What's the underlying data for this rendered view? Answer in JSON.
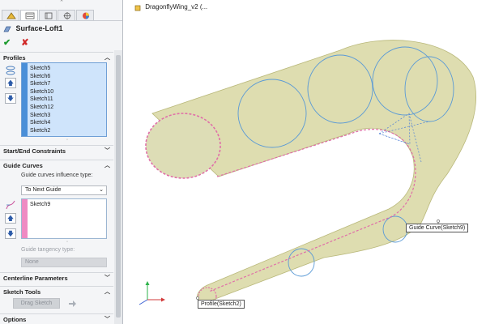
{
  "window": {
    "breadcrumb": "DragonflyWing_v2 (..."
  },
  "panel": {
    "feature_title": "Surface-Loft1",
    "tabs": [
      "feature-manager-tab",
      "property-manager-tab",
      "configuration-manager-tab",
      "dimxpert-manager-tab",
      "display-manager-tab"
    ],
    "ok_glyph": "✔",
    "cancel_glyph": "✘",
    "profiles": {
      "heading": "Profiles",
      "items": [
        "Sketch5",
        "Sketch6",
        "Sketch7",
        "Sketch10",
        "Sketch11",
        "Sketch12",
        "Sketch3",
        "Sketch4",
        "Sketch2"
      ]
    },
    "start_end_heading": "Start/End Constraints",
    "guide_curves": {
      "heading": "Guide Curves",
      "influence_label": "Guide curves influence type:",
      "influence_value": "To Next Guide",
      "items": [
        "Sketch9"
      ],
      "tangency_label": "Guide tangency type:",
      "tangency_value": "None"
    },
    "centerline_heading": "Centerline Parameters",
    "sketch_tools": {
      "heading": "Sketch Tools",
      "drag_label": "Drag Sketch"
    },
    "options_heading": "Options"
  },
  "graphics": {
    "callout_guide": "Guide Curve(Sketch9)",
    "callout_profile": "Profile(Sketch2)"
  },
  "colors": {
    "profile_stripe": "#4a8fd8",
    "guide_stripe": "#ef8ac3",
    "surface_fill": "#d8d7a2",
    "profile_edge": "#e06ea8",
    "section_lines": "#5a9ad6"
  }
}
